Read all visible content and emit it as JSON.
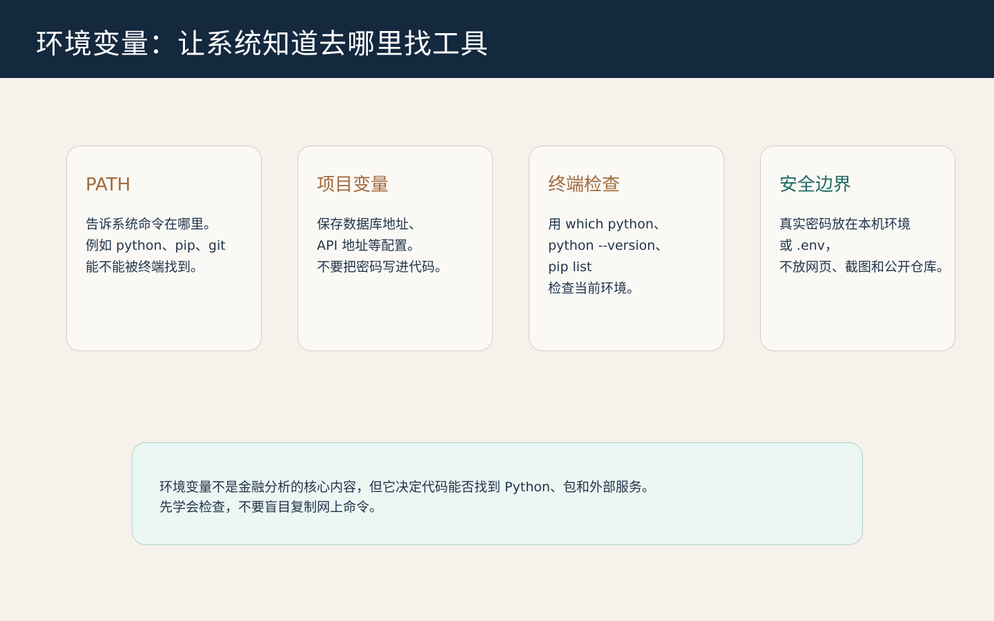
{
  "header": {
    "title": "环境变量：让系统知道去哪里找工具"
  },
  "colors": {
    "header_bg": "#14283e",
    "page_bg": "#f6f1ea",
    "accent_brown": "#a06a3c",
    "accent_teal": "#1e6b62"
  },
  "cards": [
    {
      "title": "PATH",
      "title_color": "#a06a3c",
      "lines": [
        "告诉系统命令在哪里。",
        "例如 python、pip、git",
        "能不能被终端找到。"
      ]
    },
    {
      "title": "项目变量",
      "title_color": "#a06a3c",
      "lines": [
        "保存数据库地址、",
        "API 地址等配置。",
        "不要把密码写进代码。"
      ]
    },
    {
      "title": "终端检查",
      "title_color": "#a06a3c",
      "lines": [
        "用 which python、",
        "python --version、",
        "pip list",
        "检查当前环境。"
      ]
    },
    {
      "title": "安全边界",
      "title_color": "#1e6b62",
      "lines": [
        "真实密码放在本机环境",
        "或 .env，",
        "不放网页、截图和公开仓库。"
      ]
    }
  ],
  "note": {
    "lines": [
      "环境变量不是金融分析的核心内容，但它决定代码能否找到 Python、包和外部服务。",
      "先学会检查，不要盲目复制网上命令。"
    ]
  }
}
